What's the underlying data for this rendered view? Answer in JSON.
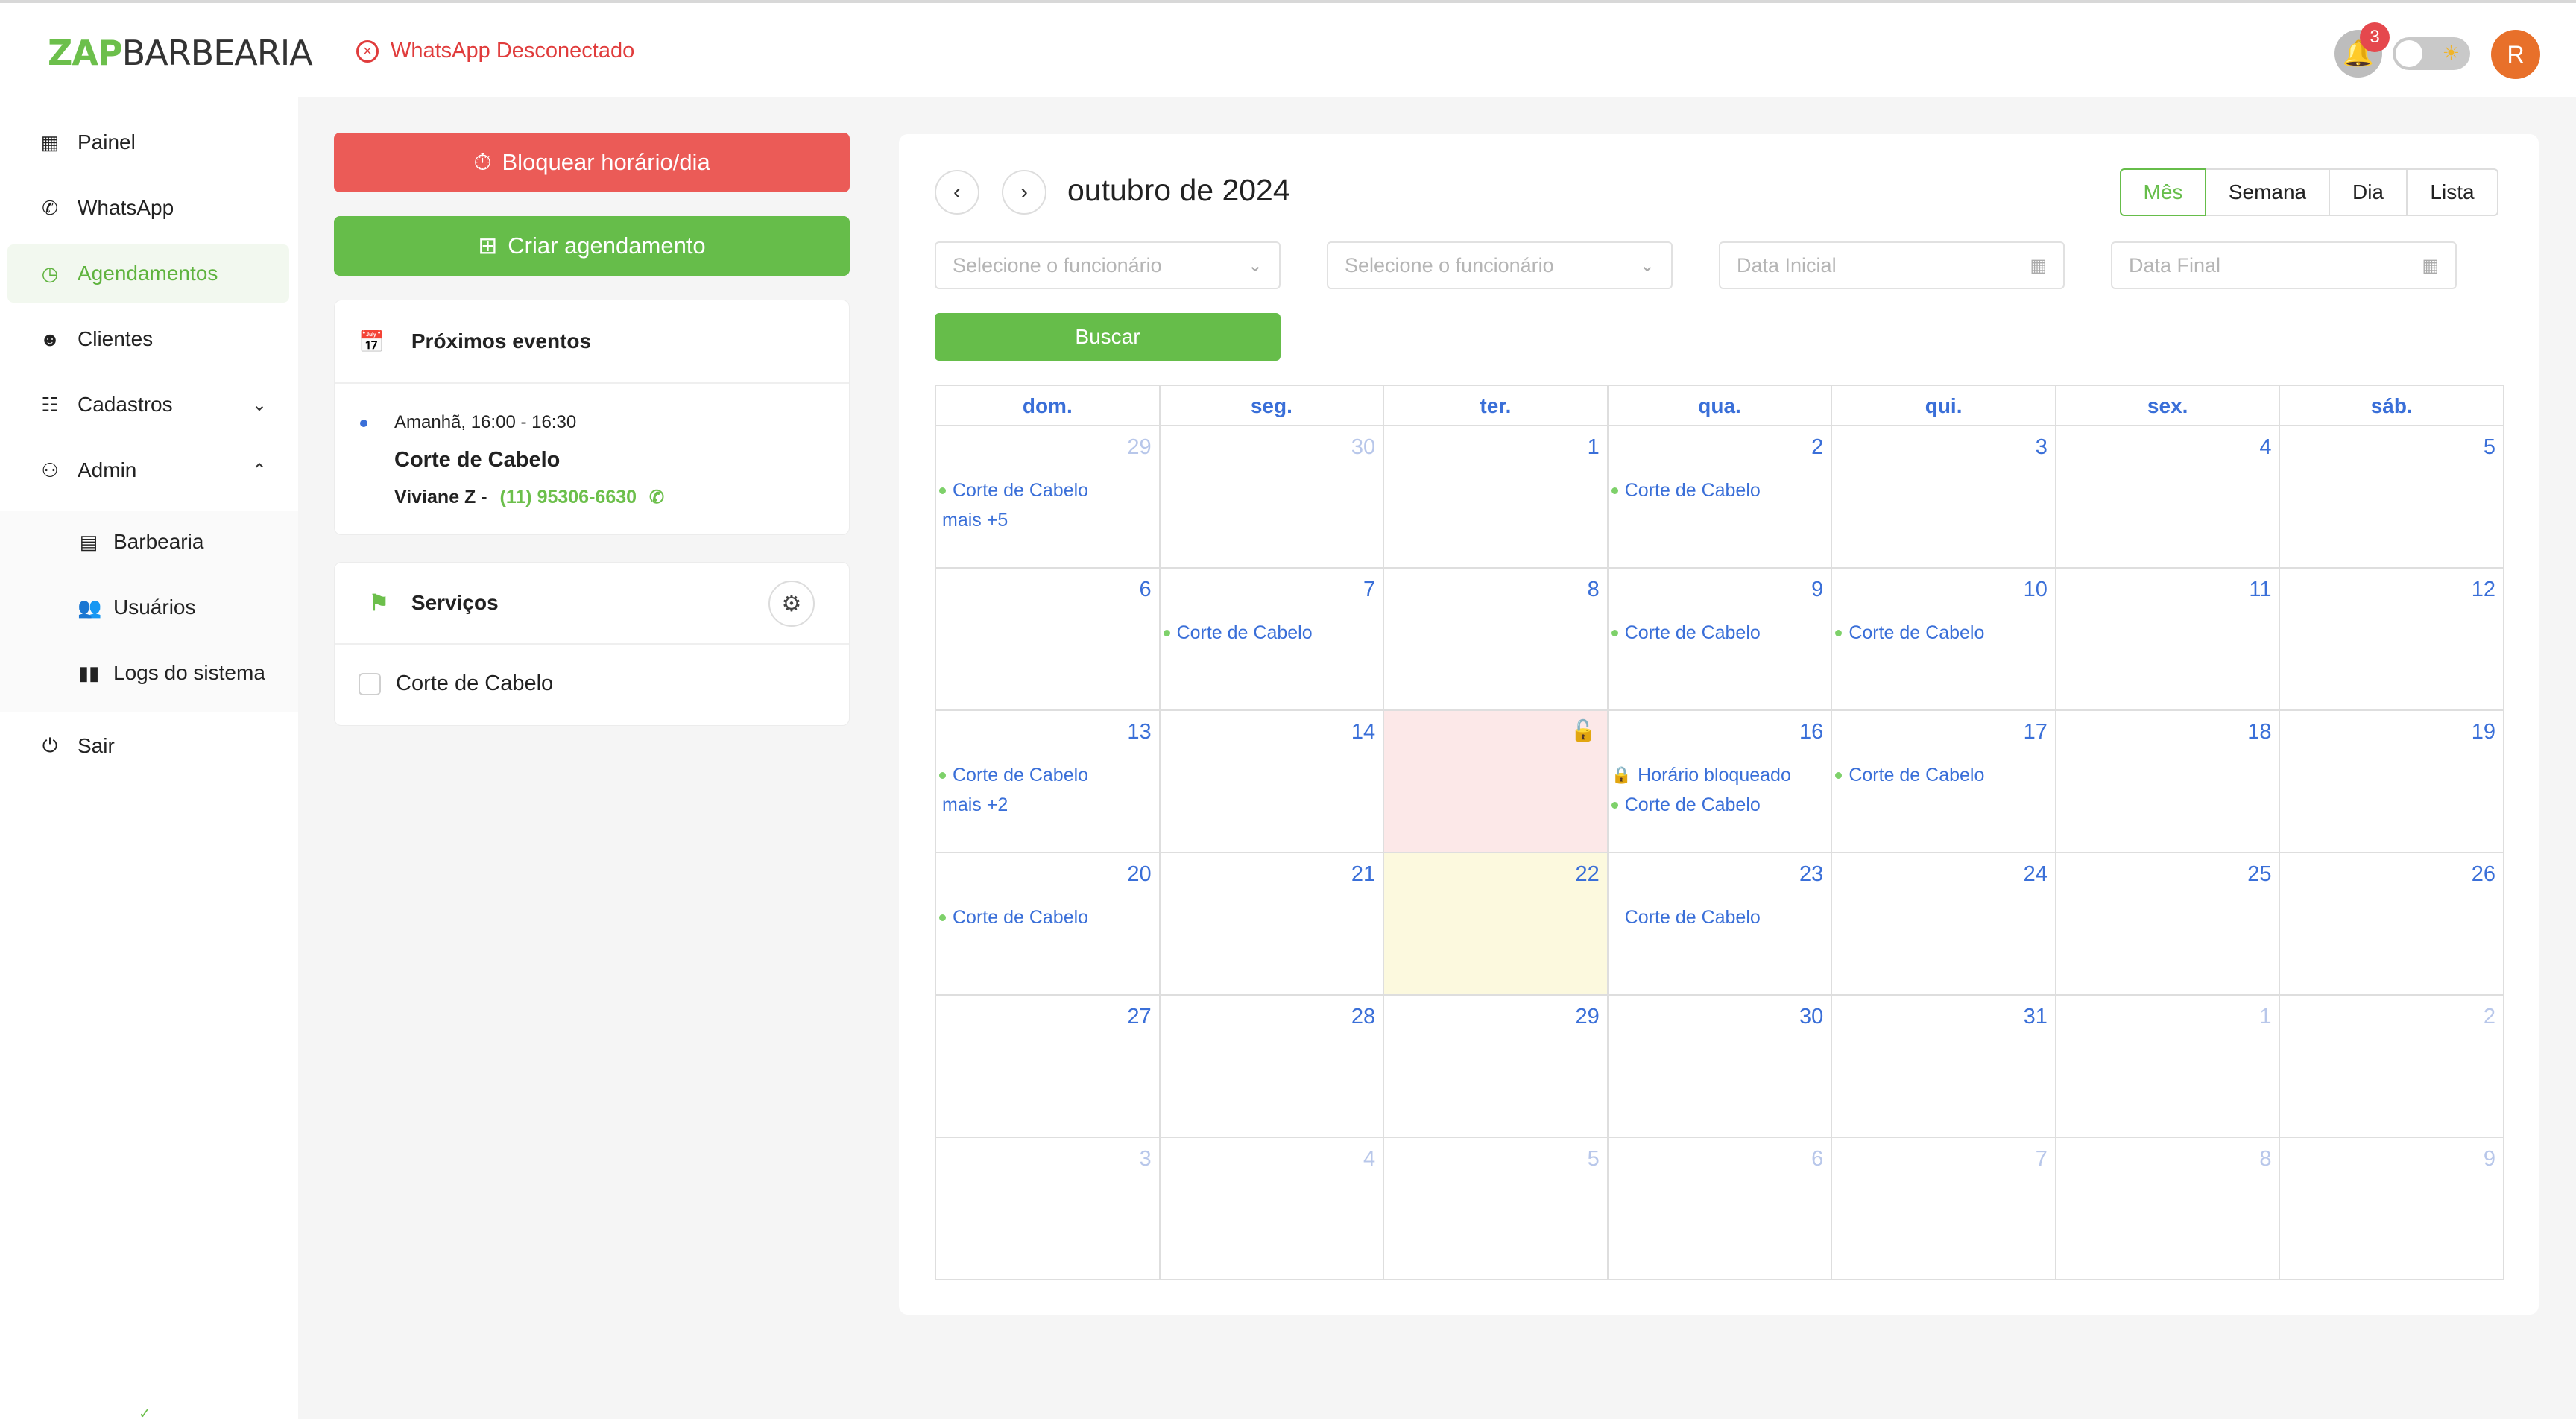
{
  "brand": {
    "zap": "ZAP",
    "rest": "BARBEARIA"
  },
  "whatsapp_status": {
    "label": "WhatsApp Desconectado",
    "color": "#e03c3c"
  },
  "notifications": {
    "count": "3"
  },
  "user": {
    "initial": "R"
  },
  "sidebar": {
    "items": [
      {
        "label": "Painel",
        "icon": "grid-icon"
      },
      {
        "label": "WhatsApp",
        "icon": "whatsapp-icon"
      },
      {
        "label": "Agendamentos",
        "icon": "clock-icon"
      },
      {
        "label": "Clientes",
        "icon": "smile-icon"
      },
      {
        "label": "Cadastros",
        "icon": "list-icon"
      },
      {
        "label": "Admin",
        "icon": "users-icon"
      },
      {
        "label": "Barbearia",
        "icon": "store-icon"
      },
      {
        "label": "Usuários",
        "icon": "team-icon"
      },
      {
        "label": "Logs do sistema",
        "icon": "book-icon"
      },
      {
        "label": "Sair",
        "icon": "logout-icon"
      }
    ]
  },
  "actions": {
    "block_label": "Bloquear horário/dia",
    "create_label": "Criar agendamento"
  },
  "upcoming": {
    "title": "Próximos eventos",
    "event": {
      "time": "Amanhã, 16:00 - 16:30",
      "title": "Corte de Cabelo",
      "client": "Viviane Z -",
      "phone": "(11) 95306-6630"
    }
  },
  "services": {
    "title": "Serviços",
    "items": [
      {
        "label": "Corte de Cabelo"
      }
    ]
  },
  "calendar": {
    "title": "outubro de 2024",
    "views": [
      "Mês",
      "Semana",
      "Dia",
      "Lista"
    ],
    "active_view": "Mês",
    "filters": {
      "employee1": "Selecione o funcionário",
      "employee2": "Selecione o funcionário",
      "start_date": "Data Inicial",
      "end_date": "Data Final"
    },
    "search_label": "Buscar",
    "weekdays": [
      "dom.",
      "seg.",
      "ter.",
      "qua.",
      "qui.",
      "sex.",
      "sáb."
    ],
    "weeks": [
      [
        {
          "n": "29",
          "o": true,
          "ev": [
            {
              "t": "Corte de Cabelo",
              "dot": true
            }
          ],
          "more": "mais +5"
        },
        {
          "n": "30",
          "o": true
        },
        {
          "n": "1"
        },
        {
          "n": "2",
          "ev": [
            {
              "t": "Corte de Cabelo",
              "dot": true
            }
          ]
        },
        {
          "n": "3"
        },
        {
          "n": "4"
        },
        {
          "n": "5"
        }
      ],
      [
        {
          "n": "6"
        },
        {
          "n": "7",
          "ev": [
            {
              "t": "Corte de Cabelo",
              "dot": true
            }
          ]
        },
        {
          "n": "8"
        },
        {
          "n": "9",
          "ev": [
            {
              "t": "Corte de Cabelo",
              "dot": true
            }
          ]
        },
        {
          "n": "10",
          "ev": [
            {
              "t": "Corte de Cabelo",
              "dot": true
            }
          ]
        },
        {
          "n": "11"
        },
        {
          "n": "12"
        }
      ],
      [
        {
          "n": "13",
          "ev": [
            {
              "t": "Corte de Cabelo",
              "dot": true
            }
          ],
          "more": "mais +2"
        },
        {
          "n": "14"
        },
        {
          "n": "",
          "blocked": true
        },
        {
          "n": "16",
          "ev": [
            {
              "t": "Horário bloqueado",
              "lock": true
            },
            {
              "t": "Corte de Cabelo",
              "dot": true
            }
          ]
        },
        {
          "n": "17",
          "ev": [
            {
              "t": "Corte de Cabelo",
              "dot": true
            }
          ]
        },
        {
          "n": "18"
        },
        {
          "n": "19"
        }
      ],
      [
        {
          "n": "20",
          "ev": [
            {
              "t": "Corte de Cabelo",
              "dot": true
            }
          ]
        },
        {
          "n": "21"
        },
        {
          "n": "22",
          "today": true
        },
        {
          "n": "23",
          "ev": [
            {
              "t": "Corte de Cabelo",
              "dot": false
            }
          ]
        },
        {
          "n": "24"
        },
        {
          "n": "25"
        },
        {
          "n": "26"
        }
      ],
      [
        {
          "n": "27"
        },
        {
          "n": "28"
        },
        {
          "n": "29"
        },
        {
          "n": "30"
        },
        {
          "n": "31"
        },
        {
          "n": "1",
          "o": true
        },
        {
          "n": "2",
          "o": true
        }
      ],
      [
        {
          "n": "3",
          "o": true
        },
        {
          "n": "4",
          "o": true
        },
        {
          "n": "5",
          "o": true
        },
        {
          "n": "6",
          "o": true
        },
        {
          "n": "7",
          "o": true
        },
        {
          "n": "8",
          "o": true
        },
        {
          "n": "9",
          "o": true
        }
      ]
    ]
  },
  "colors": {
    "brand_green": "#66bd4a",
    "danger_red": "#eb5b57",
    "link_blue": "#3a6fd8"
  }
}
